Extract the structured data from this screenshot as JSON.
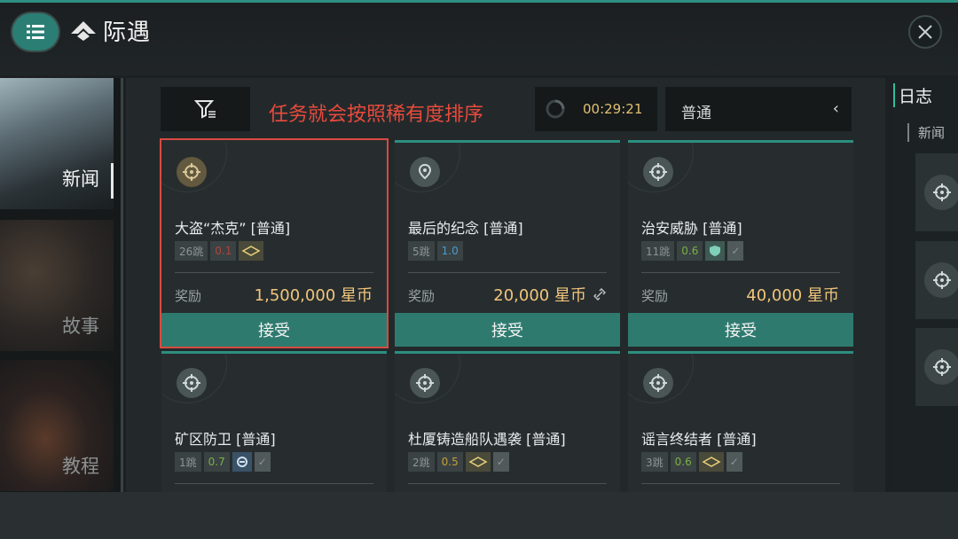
{
  "header": {
    "title": "际遇",
    "menu_icon": "hamburger-icon",
    "close_icon": "close-icon"
  },
  "left_nav": {
    "items": [
      {
        "label": "新闻",
        "active": true
      },
      {
        "label": "故事",
        "active": false
      },
      {
        "label": "教程",
        "active": false
      }
    ]
  },
  "toolbar": {
    "filter_icon": "filter-icon",
    "annotation": "任务就会按照稀有度排序",
    "timer": "00:29:21",
    "rarity": "普通",
    "chevron": "‹"
  },
  "cards": [
    {
      "title": "大盗“杰克” [普通]",
      "jumps": "26跳",
      "security": "0.1",
      "reward_label": "奖励",
      "reward": "1,500,000 星币",
      "button": "接受"
    },
    {
      "title": "最后的纪念 [普通]",
      "jumps": "5跳",
      "security": "1.0",
      "reward_label": "奖励",
      "reward": "20,000 星币",
      "button": "接受"
    },
    {
      "title": "治安威胁 [普通]",
      "jumps": "11跳",
      "security": "0.6",
      "reward_label": "奖励",
      "reward": "40,000 星币",
      "button": "接受"
    },
    {
      "title": "矿区防卫 [普通]",
      "jumps": "1跳",
      "security": "0.7"
    },
    {
      "title": "杜厦铸造船队遇袭 [普通]",
      "jumps": "2跳",
      "security": "0.5"
    },
    {
      "title": "谣言终结者 [普通]",
      "jumps": "3跳",
      "security": "0.6"
    }
  ],
  "right_panel": {
    "title": "日志",
    "subtitle": "新闻"
  },
  "colors": {
    "accent": "#2f7a6f",
    "reward": "#f1c57a",
    "annotation": "#e84a3c",
    "highlight_border": "#d94a40"
  }
}
